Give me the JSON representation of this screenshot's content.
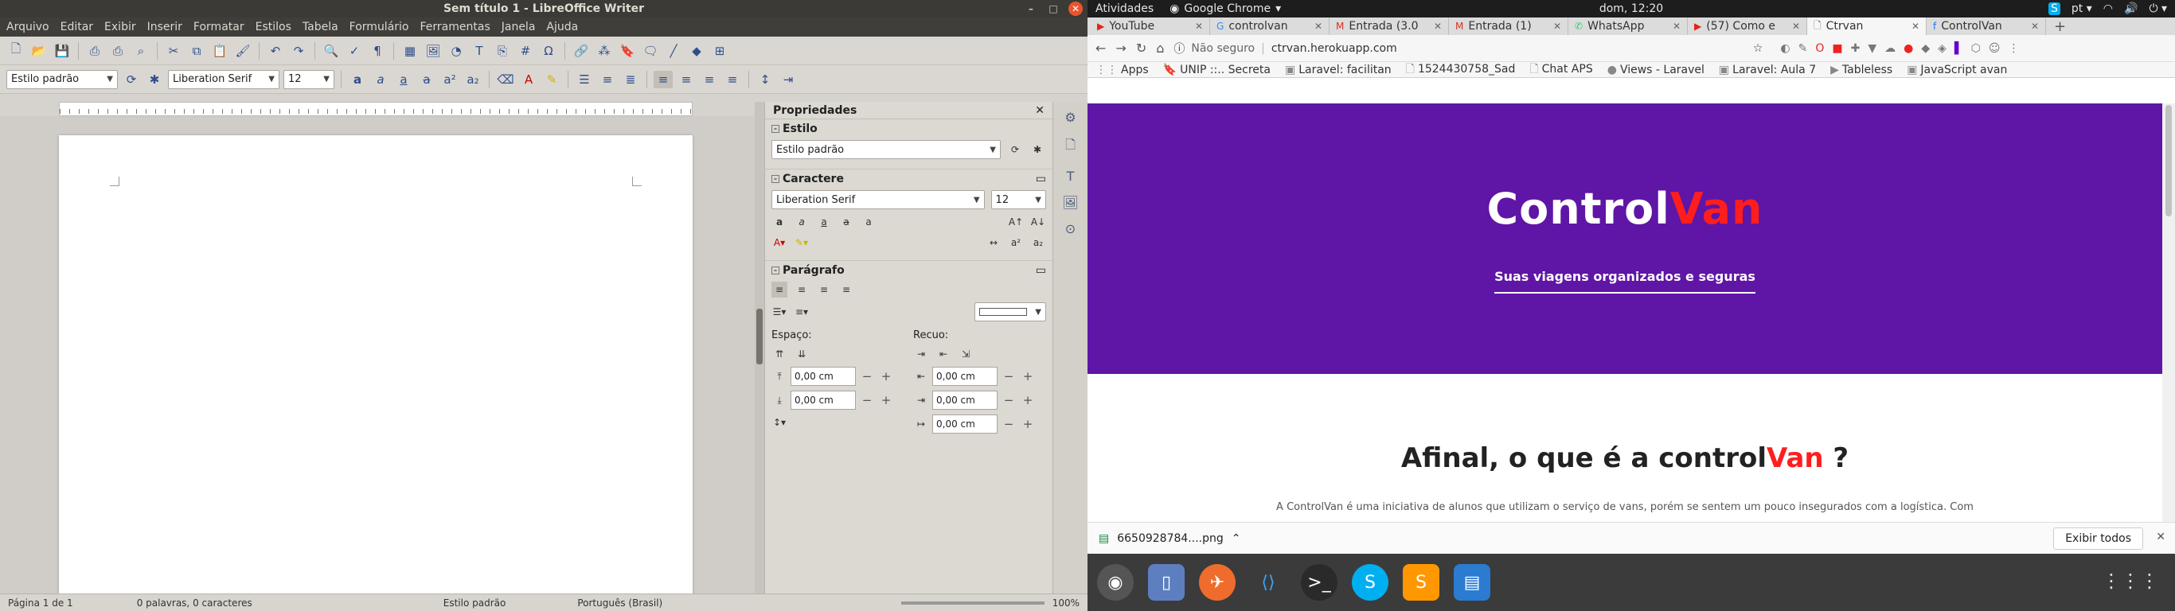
{
  "writer": {
    "window_title": "Sem título 1 - LibreOffice Writer",
    "menu": [
      "Arquivo",
      "Editar",
      "Exibir",
      "Inserir",
      "Formatar",
      "Estilos",
      "Tabela",
      "Formulário",
      "Ferramentas",
      "Janela",
      "Ajuda"
    ],
    "toolbar": {
      "paragraph_style": "Estilo padrão",
      "font_name": "Liberation Serif",
      "font_size": "12"
    },
    "sidebar": {
      "title": "Propriedades",
      "style_section": "Estilo",
      "style_value": "Estilo padrão",
      "char_section": "Caractere",
      "char_font": "Liberation Serif",
      "char_size": "12",
      "para_section": "Parágrafo",
      "spacing_label": "Espaço:",
      "indent_label": "Recuo:",
      "spacing_values": [
        "0,00 cm",
        "0,00 cm"
      ],
      "indent_values": [
        "0,00 cm",
        "0,00 cm",
        "0,00 cm"
      ]
    },
    "status": {
      "page": "Página 1 de 1",
      "words": "0 palavras, 0 caracteres",
      "style": "Estilo padrão",
      "language": "Português (Brasil)",
      "zoom": "100%"
    }
  },
  "system": {
    "activities": "Atividades",
    "app_name": "Google Chrome",
    "clock": "dom, 12:20",
    "lang": "pt"
  },
  "chrome": {
    "tabs": [
      "YouTube",
      "controlvan",
      "Entrada (3.0",
      "Entrada (1)",
      "WhatsApp",
      "(57) Como e",
      "Ctrvan",
      "ControlVan"
    ],
    "active_tab": 6,
    "not_secure": "Não seguro",
    "url": "ctrvan.herokuapp.com",
    "bookmarks": [
      "Apps",
      "UNIP ::.. Secreta",
      "Laravel: facilitan",
      "1524430758_Sad",
      "Chat APS",
      "Views - Laravel",
      "Laravel: Aula 7",
      "Tableless",
      "JavaScript avan"
    ],
    "download_file": "6650928784....png",
    "show_all": "Exibir todos"
  },
  "site": {
    "logo_main": "Control",
    "logo_accent": "Van",
    "tagline": "Suas viagens organizados e seguras",
    "heading_main": "Afinal, o que é a control",
    "heading_accent": "Van",
    "heading_end": " ?",
    "intro": "A ControlVan é uma iniciativa de alunos que utilizam o serviço de vans, porém se sentem um pouco insegurados com a logística. Com"
  },
  "colors": {
    "hero": "#5f15a6",
    "accent": "#ff1e1e"
  }
}
